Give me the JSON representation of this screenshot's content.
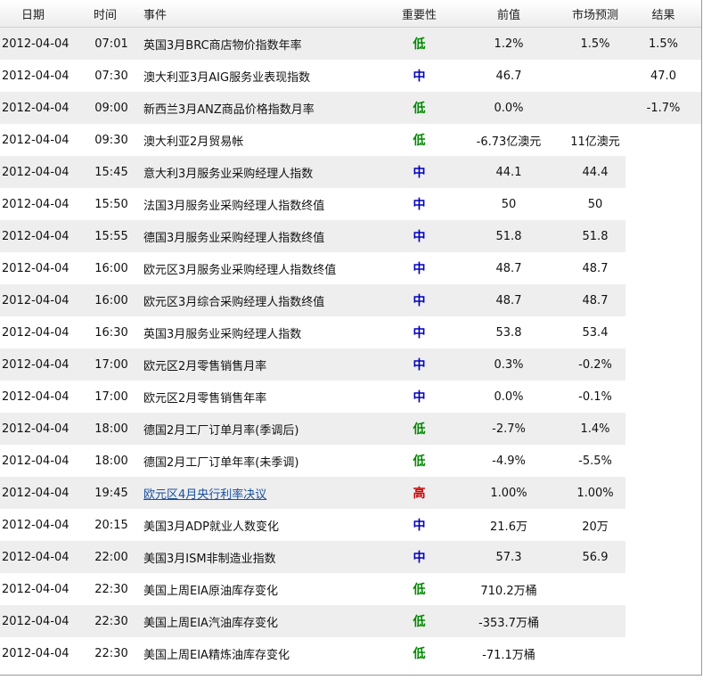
{
  "headers": {
    "date": "日期",
    "time": "时间",
    "event": "事件",
    "importance": "重要性",
    "previous": "前值",
    "forecast": "市场预测",
    "result": "结果"
  },
  "importance_colors": {
    "低": "#008800",
    "中": "#0000bb",
    "高": "#cc0000"
  },
  "rows": [
    {
      "date": "2012-04-04",
      "time": "07:01",
      "event": "英国3月BRC商店物价指数年率",
      "importance": "低",
      "previous": "1.2%",
      "forecast": "1.5%",
      "result": "1.5%"
    },
    {
      "date": "2012-04-04",
      "time": "07:30",
      "event": "澳大利亚3月AIG服务业表现指数",
      "importance": "中",
      "previous": "46.7",
      "forecast": "",
      "result": "47.0"
    },
    {
      "date": "2012-04-04",
      "time": "09:00",
      "event": "新西兰3月ANZ商品价格指数月率",
      "importance": "低",
      "previous": "0.0%",
      "forecast": "",
      "result": "-1.7%"
    },
    {
      "date": "2012-04-04",
      "time": "09:30",
      "event": "澳大利亚2月贸易帐",
      "importance": "低",
      "previous": "-6.73亿澳元",
      "forecast": "11亿澳元",
      "result": ""
    },
    {
      "date": "2012-04-04",
      "time": "15:45",
      "event": "意大利3月服务业采购经理人指数",
      "importance": "中",
      "previous": "44.1",
      "forecast": "44.4",
      "result": ""
    },
    {
      "date": "2012-04-04",
      "time": "15:50",
      "event": "法国3月服务业采购经理人指数终值",
      "importance": "中",
      "previous": "50",
      "forecast": "50",
      "result": ""
    },
    {
      "date": "2012-04-04",
      "time": "15:55",
      "event": "德国3月服务业采购经理人指数终值",
      "importance": "中",
      "previous": "51.8",
      "forecast": "51.8",
      "result": ""
    },
    {
      "date": "2012-04-04",
      "time": "16:00",
      "event": "欧元区3月服务业采购经理人指数终值",
      "importance": "中",
      "previous": "48.7",
      "forecast": "48.7",
      "result": ""
    },
    {
      "date": "2012-04-04",
      "time": "16:00",
      "event": "欧元区3月综合采购经理人指数终值",
      "importance": "中",
      "previous": "48.7",
      "forecast": "48.7",
      "result": ""
    },
    {
      "date": "2012-04-04",
      "time": "16:30",
      "event": "英国3月服务业采购经理人指数",
      "importance": "中",
      "previous": "53.8",
      "forecast": "53.4",
      "result": ""
    },
    {
      "date": "2012-04-04",
      "time": "17:00",
      "event": "欧元区2月零售销售月率",
      "importance": "中",
      "previous": "0.3%",
      "forecast": "-0.2%",
      "result": ""
    },
    {
      "date": "2012-04-04",
      "time": "17:00",
      "event": "欧元区2月零售销售年率",
      "importance": "中",
      "previous": "0.0%",
      "forecast": "-0.1%",
      "result": ""
    },
    {
      "date": "2012-04-04",
      "time": "18:00",
      "event": "德国2月工厂订单月率(季调后)",
      "importance": "低",
      "previous": "-2.7%",
      "forecast": "1.4%",
      "result": ""
    },
    {
      "date": "2012-04-04",
      "time": "18:00",
      "event": "德国2月工厂订单年率(未季调)",
      "importance": "低",
      "previous": "-4.9%",
      "forecast": "-5.5%",
      "result": ""
    },
    {
      "date": "2012-04-04",
      "time": "19:45",
      "event": "欧元区4月央行利率决议",
      "importance": "高",
      "previous": "1.00%",
      "forecast": "1.00%",
      "result": "",
      "link": true
    },
    {
      "date": "2012-04-04",
      "time": "20:15",
      "event": "美国3月ADP就业人数变化",
      "importance": "中",
      "previous": "21.6万",
      "forecast": "20万",
      "result": ""
    },
    {
      "date": "2012-04-04",
      "time": "22:00",
      "event": "美国3月ISM非制造业指数",
      "importance": "中",
      "previous": "57.3",
      "forecast": "56.9",
      "result": ""
    },
    {
      "date": "2012-04-04",
      "time": "22:30",
      "event": "美国上周EIA原油库存变化",
      "importance": "低",
      "previous": "710.2万桶",
      "forecast": "",
      "result": ""
    },
    {
      "date": "2012-04-04",
      "time": "22:30",
      "event": "美国上周EIA汽油库存变化",
      "importance": "低",
      "previous": "-353.7万桶",
      "forecast": "",
      "result": ""
    },
    {
      "date": "2012-04-04",
      "time": "22:30",
      "event": "美国上周EIA精炼油库存变化",
      "importance": "低",
      "previous": "-71.1万桶",
      "forecast": "",
      "result": ""
    }
  ]
}
